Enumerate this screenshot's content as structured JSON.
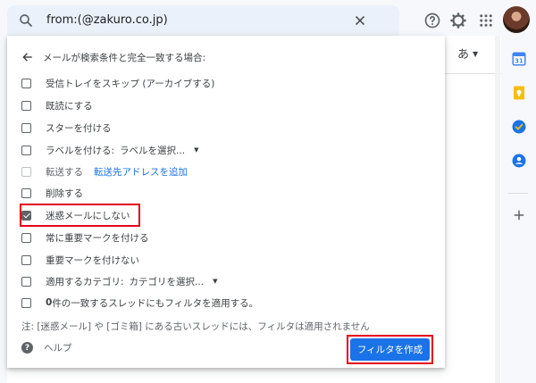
{
  "search": {
    "query": "from:(@zakuro.co.jp)"
  },
  "header": {
    "lang_label": "あ"
  },
  "dialog": {
    "header_text": "メールが検索条件と完全一致する場合:",
    "options": [
      {
        "label": "受信トレイをスキップ (アーカイブする)",
        "checked": false
      },
      {
        "label": "既読にする",
        "checked": false
      },
      {
        "label": "スターを付ける",
        "checked": false
      },
      {
        "label": "ラベルを付ける:",
        "select_value": "ラベルを選択...",
        "checked": false
      },
      {
        "label": "転送する",
        "link": "転送先アドレスを追加",
        "checked": false,
        "disabled": true
      },
      {
        "label": "削除する",
        "checked": false
      },
      {
        "label": "迷惑メールにしない",
        "checked": true
      },
      {
        "label": "常に重要マークを付ける",
        "checked": false
      },
      {
        "label": "重要マークを付けない",
        "checked": false
      },
      {
        "label": "適用するカテゴリ:",
        "select_value": "カテゴリを選択...",
        "checked": false
      },
      {
        "label_prefix": "0",
        "label": " 件の一致するスレッドにもフィルタを適用する。",
        "checked": false
      }
    ],
    "note": "注: [迷惑メール] や [ゴミ箱] にある古いスレッドには、フィルタは適用されません",
    "help_label": "ヘルプ",
    "create_button": "フィルタを作成"
  },
  "colors": {
    "accent": "#1a73e8",
    "highlight": "#e4001b",
    "calendar": "#4285f4",
    "keep": "#fbbc04",
    "tasks": "#1a73e8",
    "contacts": "#1a73e8"
  }
}
